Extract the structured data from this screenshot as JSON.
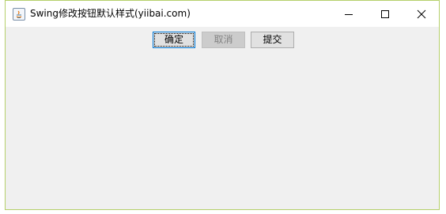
{
  "window": {
    "title": "Swing修改按钮默认样式(yiibai.com)",
    "icon": "java-icon",
    "controls": {
      "minimize": "minimize-icon",
      "maximize": "maximize-icon",
      "close": "close-icon"
    }
  },
  "buttons": {
    "confirm_label": "确定",
    "cancel_label": "取消",
    "submit_label": "提交",
    "cancel_enabled": false
  },
  "colors": {
    "frame_border": "#b5cf6a",
    "focus_border": "#0078d7",
    "disabled_text": "#838383"
  }
}
